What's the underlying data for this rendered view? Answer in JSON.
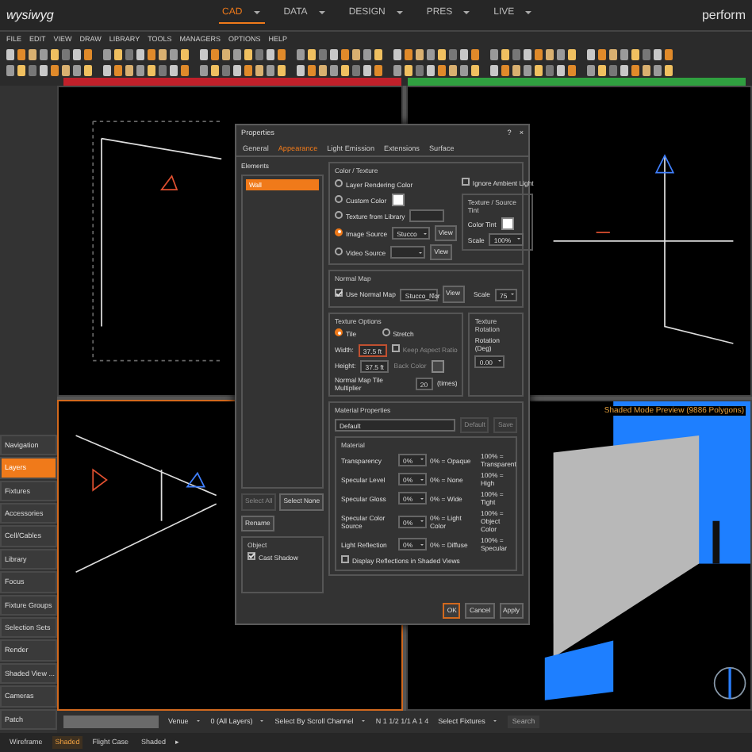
{
  "app": {
    "logo": "wysiwyg",
    "brand": "perform",
    "modes": [
      {
        "label": "CAD",
        "selected": true
      },
      {
        "label": "DATA",
        "selected": false
      },
      {
        "label": "DESIGN",
        "selected": false
      },
      {
        "label": "PRES",
        "selected": false
      },
      {
        "label": "LIVE",
        "selected": false
      }
    ]
  },
  "menu": [
    "FILE",
    "EDIT",
    "VIEW",
    "DRAW",
    "LIBRARY",
    "TOOLS",
    "MANAGERS",
    "OPTIONS",
    "HELP"
  ],
  "sidebar": {
    "items": [
      {
        "label": "Navigation",
        "selected": false
      },
      {
        "label": "Layers",
        "selected": true
      },
      {
        "label": "Fixtures",
        "selected": false
      },
      {
        "label": "Accessories",
        "selected": false
      },
      {
        "label": "Cell/Cables",
        "selected": false
      },
      {
        "label": "Library",
        "selected": false
      },
      {
        "label": "Focus",
        "selected": false
      },
      {
        "label": "Fixture Groups",
        "selected": false
      },
      {
        "label": "Selection Sets",
        "selected": false
      },
      {
        "label": "Render",
        "selected": false
      },
      {
        "label": "Shaded View ...",
        "selected": false
      },
      {
        "label": "Cameras",
        "selected": false
      },
      {
        "label": "Patch",
        "selected": false
      }
    ]
  },
  "viewports": [
    {
      "kind": "wireframe",
      "active": false
    },
    {
      "kind": "wireframe",
      "active": false
    },
    {
      "kind": "wireframe",
      "active": true
    },
    {
      "kind": "shaded",
      "active": false,
      "caption": "Shaded Mode Preview (9886 Polygons)"
    }
  ],
  "dialog": {
    "title": "Properties",
    "help": "?",
    "close": "×",
    "tabs": [
      {
        "label": "General",
        "selected": false
      },
      {
        "label": "Appearance",
        "selected": true
      },
      {
        "label": "Light Emission",
        "selected": false
      },
      {
        "label": "Extensions",
        "selected": false
      },
      {
        "label": "Surface",
        "selected": false
      }
    ],
    "elements": {
      "title": "Elements",
      "items": [
        {
          "label": "Wall",
          "selected": true
        }
      ]
    },
    "select_all": {
      "label": "Select All",
      "disabled": true
    },
    "select_none": {
      "label": "Select None",
      "disabled": false
    },
    "rename": "Rename",
    "object": {
      "title": "Object",
      "cast_shadow": {
        "label": "Cast Shadow",
        "checked": true
      }
    },
    "color_texture": {
      "title": "Color / Texture",
      "ignore_ambient": {
        "label": "Ignore Ambient Light",
        "checked": false
      },
      "sources": [
        {
          "kind": "plain",
          "label": "Layer Rendering Color",
          "selected": false
        },
        {
          "kind": "swatch",
          "label": "Custom Color",
          "selected": false
        },
        {
          "kind": "field",
          "label": "Texture from Library",
          "selected": false
        },
        {
          "kind": "dropdown",
          "label": "Image Source",
          "selected": true,
          "value": "Stucco",
          "button": "View"
        },
        {
          "kind": "dropdown",
          "label": "Video Source",
          "selected": false,
          "button": "View"
        }
      ],
      "tint": {
        "title": "Texture / Source Tint",
        "color_label": "Color Tint",
        "scale_label": "Scale",
        "scale": "100%"
      }
    },
    "normal_map": {
      "title": "Normal Map",
      "use": {
        "label": "Use Normal Map",
        "checked": true
      },
      "value": "Stucco_Nor",
      "button": "View",
      "scale_label": "Scale",
      "scale": "75"
    },
    "texture_options": {
      "title": "Texture Options",
      "modes": [
        {
          "label": "Tile",
          "selected": true
        },
        {
          "label": "Stretch",
          "selected": false
        }
      ],
      "width_label": "Width:",
      "width": "37.5 ft",
      "height_label": "Height:",
      "height": "37.5 ft",
      "keep_aspect": {
        "label": "Keep Aspect Ratio",
        "checked": false,
        "disabled": true
      },
      "back_color": "Back Color",
      "multiplier_label": "Normal Map Tile Multiplier",
      "multiplier": "20",
      "multiplier_unit": "(times)"
    },
    "rotation": {
      "title": "Texture Rotation",
      "label": "Rotation (Deg)",
      "value": "0.00"
    },
    "material_properties": {
      "title": "Material Properties",
      "preset": "Default",
      "buttons": [
        {
          "label": "Default",
          "disabled": true
        },
        {
          "label": "Save",
          "disabled": true
        }
      ]
    },
    "material": {
      "title": "Material",
      "rows": [
        {
          "label": "Transparency",
          "value": "0%",
          "low": "0% = Opaque",
          "high": "100% = Transparent"
        },
        {
          "label": "Specular Level",
          "value": "0%",
          "low": "0% = None",
          "high": "100% = High"
        },
        {
          "label": "Specular Gloss",
          "value": "0%",
          "low": "0% = Wide",
          "high": "100% = Tight"
        },
        {
          "label": "Specular Color Source",
          "value": "0%",
          "low": "0% = Light Color",
          "high": "100% = Object Color"
        },
        {
          "label": "Light Reflection",
          "value": "0%",
          "low": "0% = Diffuse",
          "high": "100% = Specular"
        }
      ]
    },
    "reflections": {
      "label": "Display Reflections in Shaded Views",
      "checked": false
    },
    "actions": [
      {
        "label": "OK",
        "default": true
      },
      {
        "label": "Cancel",
        "default": false
      },
      {
        "label": "Apply",
        "default": false
      }
    ]
  },
  "status_bar": {
    "layer": "Venue",
    "filter": "0 (All Layers)",
    "select_mode": "Select By Scroll Channel",
    "address": "N 1 1/2 1/1 A 1 4",
    "select": "Select Fixtures",
    "search_placeholder": "Search"
  },
  "view_tabs": [
    {
      "label": "Wireframe",
      "selected": false
    },
    {
      "label": "Shaded",
      "selected": true
    },
    {
      "label": "Flight Case",
      "selected": false
    },
    {
      "label": "Shaded",
      "selected": false
    }
  ],
  "more_tabs": "▸"
}
